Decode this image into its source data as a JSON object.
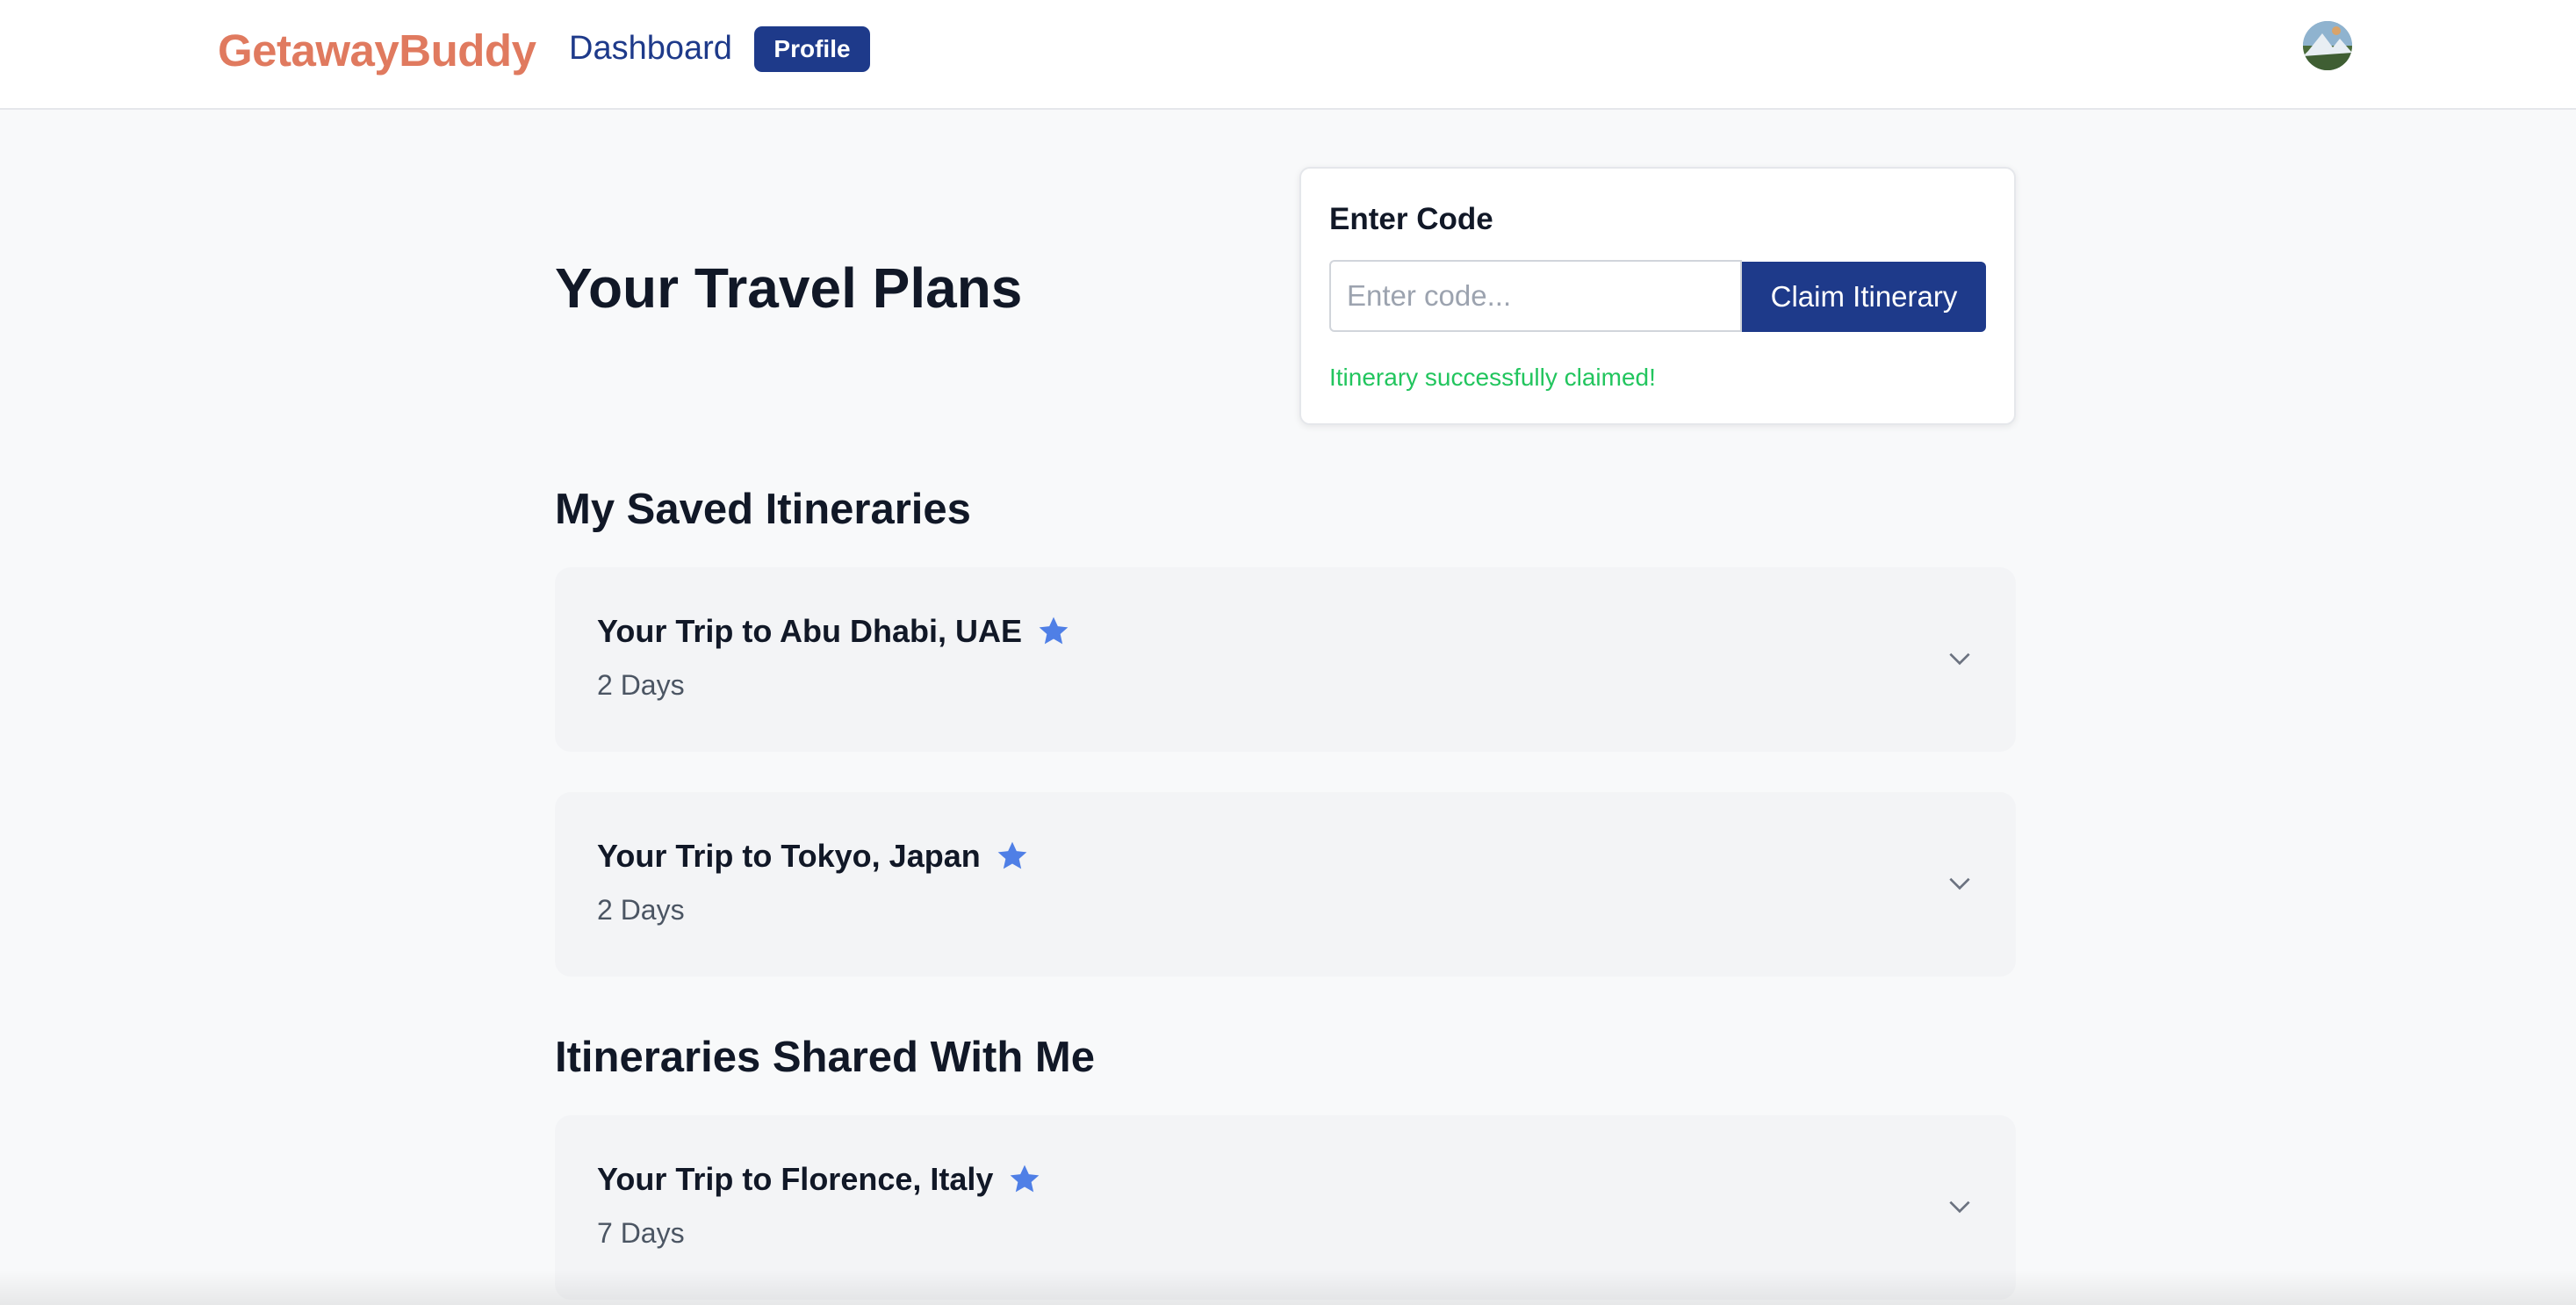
{
  "nav": {
    "brand": "GetawayBuddy",
    "dashboard_label": "Dashboard",
    "profile_label": "Profile",
    "brand_color": "#e07a5f",
    "accent_color": "#1e3a8a"
  },
  "page": {
    "title": "Your Travel Plans"
  },
  "code_card": {
    "title": "Enter Code",
    "input_placeholder": "Enter code...",
    "input_value": "",
    "button_label": "Claim Itinerary",
    "success_message": "Itinerary successfully claimed!",
    "success_color": "#22c55e"
  },
  "saved": {
    "heading": "My Saved Itineraries",
    "items": [
      {
        "title": "Your Trip to Abu Dhabi, UAE",
        "days": "2 Days",
        "starred": true
      },
      {
        "title": "Your Trip to Tokyo, Japan",
        "days": "2 Days",
        "starred": true
      }
    ]
  },
  "shared": {
    "heading": "Itineraries Shared With Me",
    "items": [
      {
        "title": "Your Trip to Florence, Italy",
        "days": "7 Days",
        "starred": true
      }
    ]
  },
  "icons": {
    "star": "star-icon",
    "chevron": "chevron-down-icon",
    "avatar": "avatar"
  }
}
